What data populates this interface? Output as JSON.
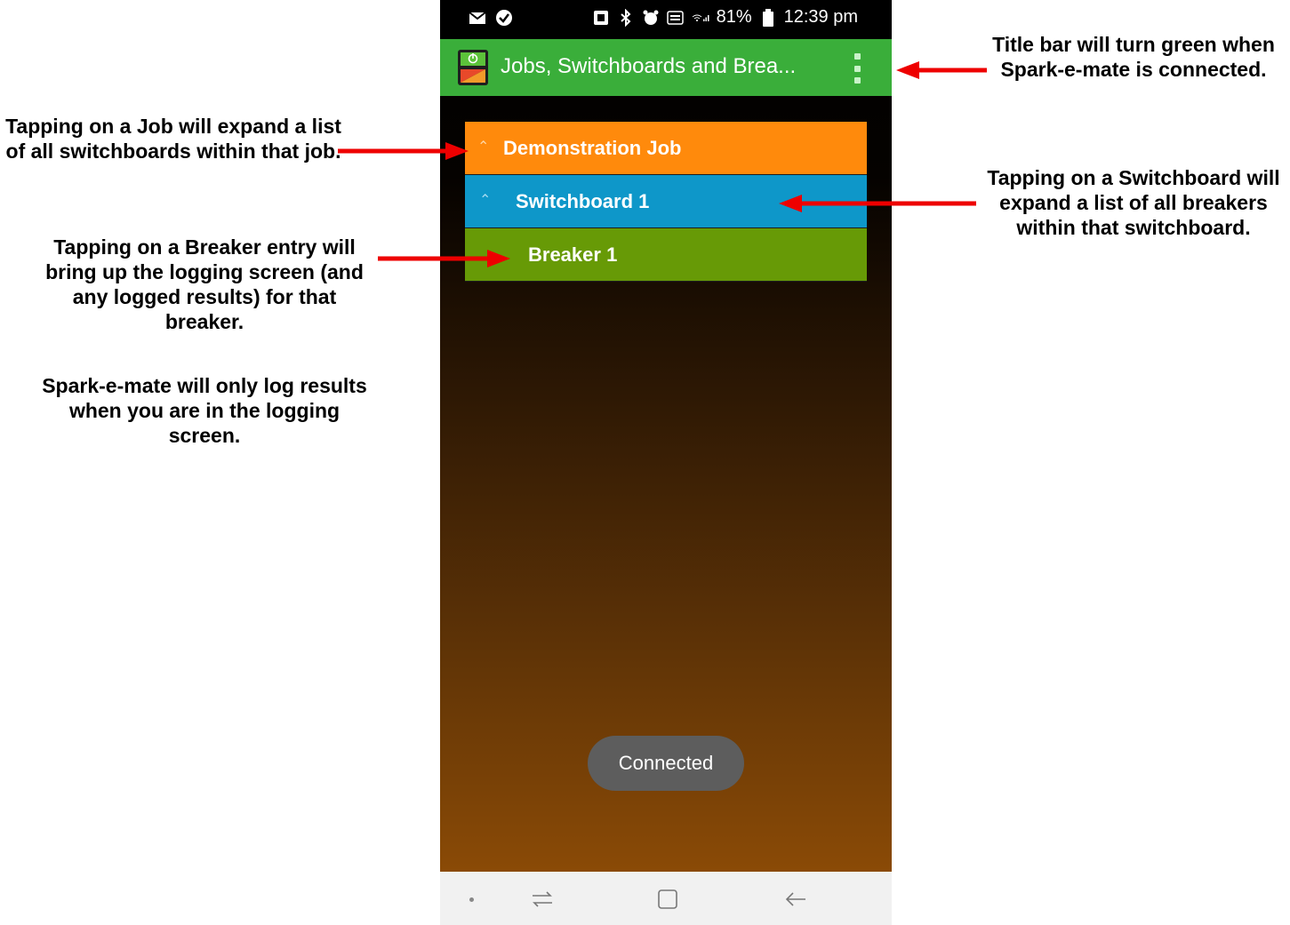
{
  "annotations": {
    "title_bar": "Title bar will turn green when Spark-e-mate is connected.",
    "job": "Tapping on a Job will expand a list of all switchboards within that job.",
    "switchboard": "Tapping on a Switchboard will expand a list of all breakers within that switchboard.",
    "breaker": "Tapping on a Breaker entry will bring up the logging screen (and any logged results) for that breaker.",
    "logging": "Spark-e-mate will only log results when you are in the logging screen."
  },
  "status_bar": {
    "battery": "81%",
    "time": "12:39 pm"
  },
  "app_bar": {
    "title": "Jobs, Switchboards and Brea...",
    "color": "#3aae3a"
  },
  "list": {
    "job": {
      "label": "Demonstration Job",
      "color": "#ff8a0c",
      "icon": "chevron-up-icon"
    },
    "switchboard": {
      "label": "Switchboard 1",
      "color": "#0e97c9",
      "icon": "chevron-up-icon"
    },
    "breaker": {
      "label": "Breaker 1",
      "color": "#679a06"
    }
  },
  "toast": {
    "text": "Connected"
  },
  "nav_bar": {
    "icons": [
      "recents-icon",
      "home-icon",
      "back-icon"
    ]
  }
}
